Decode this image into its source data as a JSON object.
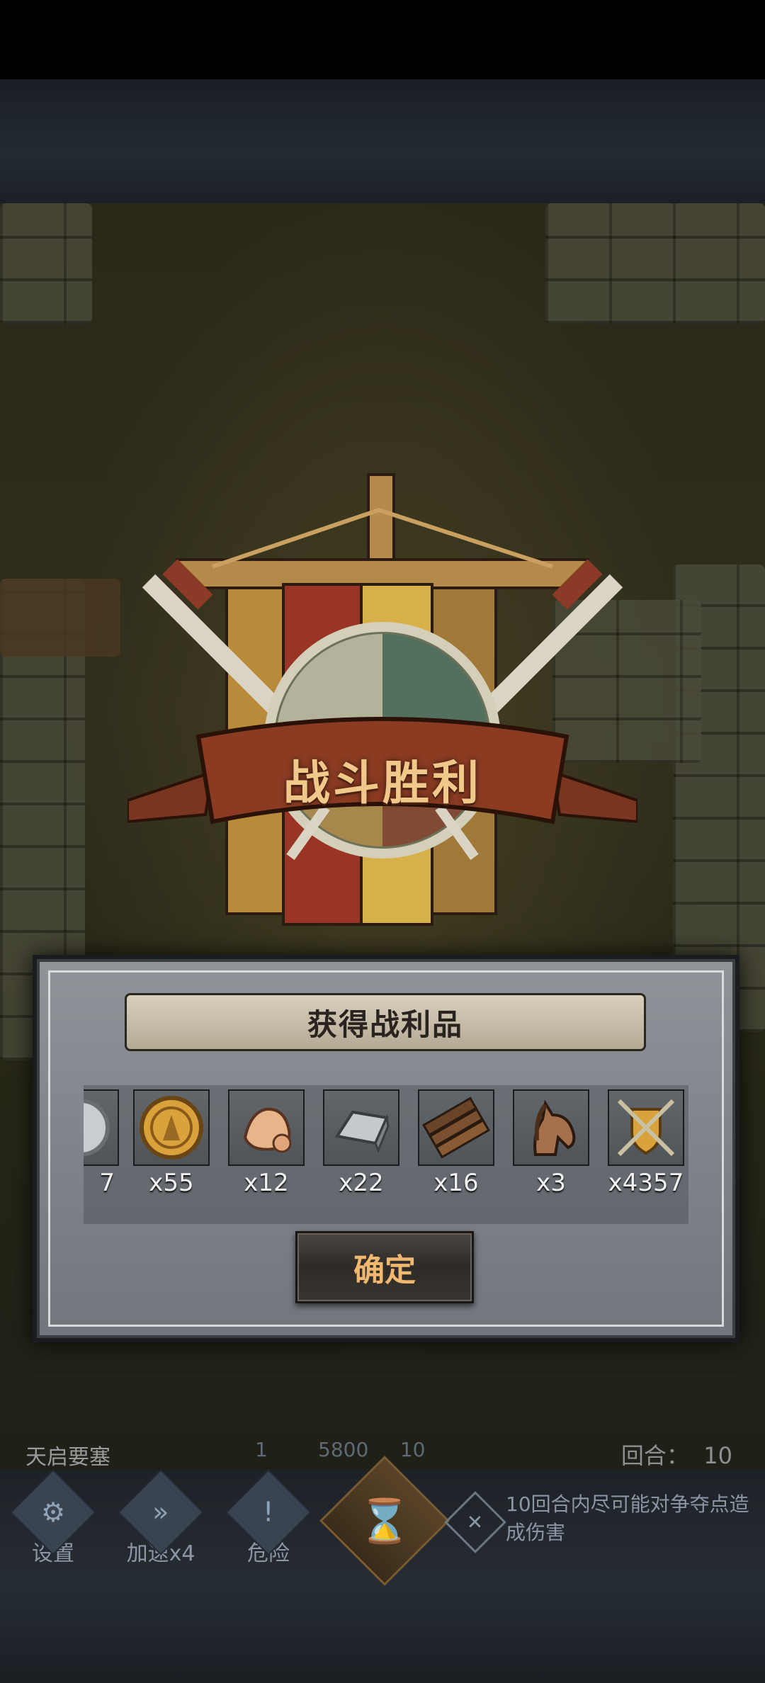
{
  "victory": {
    "title": "战斗胜利"
  },
  "loot_panel": {
    "header": "获得战利品",
    "items": [
      {
        "icon": "silver-coin-icon",
        "qty": "7"
      },
      {
        "icon": "gold-coin-icon",
        "qty": "x55"
      },
      {
        "icon": "copper-ore-icon",
        "qty": "x12"
      },
      {
        "icon": "iron-ingot-icon",
        "qty": "x22"
      },
      {
        "icon": "wood-planks-icon",
        "qty": "x16"
      },
      {
        "icon": "horse-icon",
        "qty": "x3"
      },
      {
        "icon": "honor-shield-icon",
        "qty": "x4357"
      }
    ],
    "confirm_label": "确定"
  },
  "hud": {
    "location": "天启要塞",
    "round_label": "回合：",
    "round_value": "10",
    "status_left": "1",
    "status_mid": "5800",
    "status_right": "10",
    "settings_label": "设置",
    "speed_label": "加速x4",
    "danger_label": "危险",
    "objective": "10回合内尽可能对争夺点造成伤害"
  },
  "colors": {
    "title_text": "#f0c98a",
    "confirm_text": "#f0b770",
    "ribbon": "#8a3b22",
    "panel_bg": "#7e848a"
  }
}
